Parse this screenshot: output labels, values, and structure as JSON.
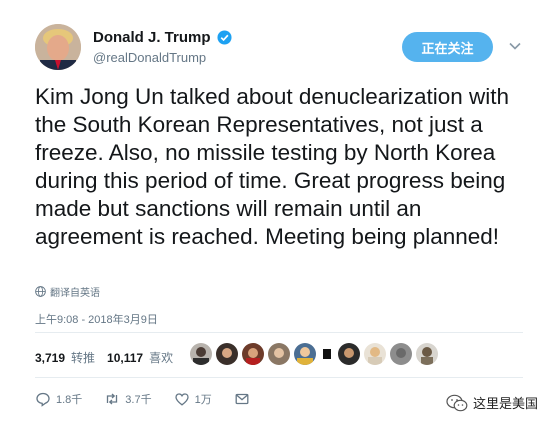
{
  "author": {
    "name": "Donald J. Trump",
    "handle": "@realDonaldTrump",
    "follow_label": "正在关注"
  },
  "tweet": {
    "text": "Kim Jong Un talked about denuclearization with the South Korean Representatives, not just a freeze. Also, no missile testing by North Korea during this period of time. Great progress being made but sanctions will remain until an agreement is reached. Meeting being planned!",
    "translate_label": "翻译自英语",
    "timestamp": "上午9:08 - 2018年3月9日"
  },
  "stats": {
    "retweets_count": "3,719",
    "retweets_label": "转推",
    "likes_count": "10,117",
    "likes_label": "喜欢"
  },
  "actions": {
    "reply_count": "1.8千",
    "retweet_count": "3.7千",
    "like_count": "1万"
  },
  "watermark": {
    "text": "这里是美国"
  },
  "colors": {
    "follow_button": "#55b3ee",
    "verified": "#1da1f2",
    "secondary_text": "#657786"
  },
  "icons": [
    "chevron-down-icon",
    "verified-badge-icon",
    "globe-icon",
    "reply-icon",
    "retweet-icon",
    "heart-icon",
    "message-icon",
    "wechat-icon"
  ]
}
